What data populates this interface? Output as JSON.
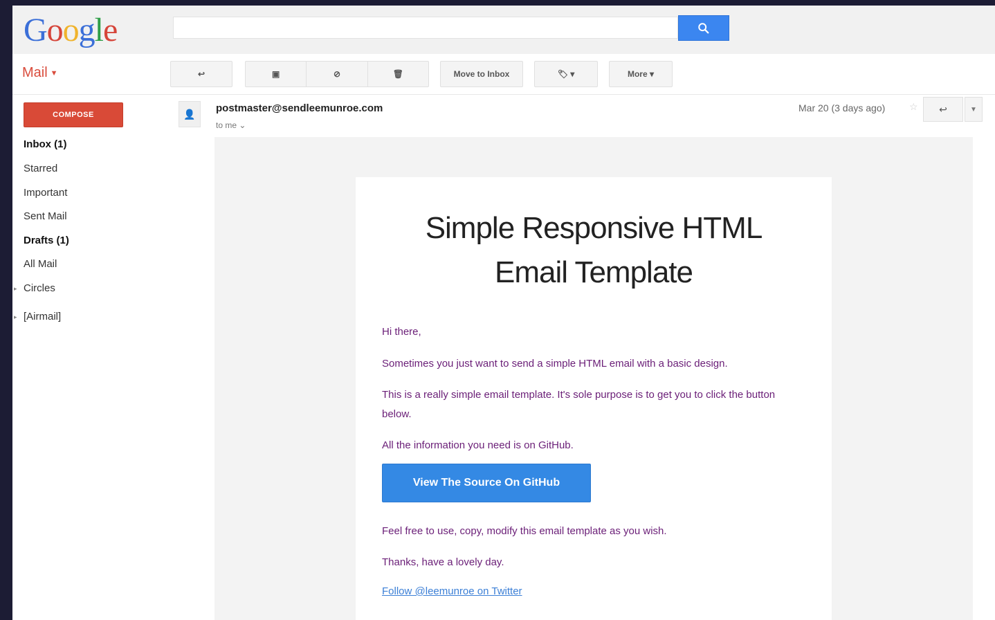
{
  "header": {
    "logo": {
      "g1": "G",
      "o1": "o",
      "o2": "o",
      "g2": "g",
      "l": "l",
      "e": "e"
    },
    "search": {
      "placeholder": ""
    }
  },
  "toolbar": {
    "mail_label": "Mail",
    "reply_label": "↩",
    "archive_label": "▣",
    "spam_label": "⊘",
    "delete_label": "🗑",
    "move_to_inbox_label": "Move to Inbox",
    "labels_label": "🏷 ▾",
    "more_label": "More ▾"
  },
  "sidebar": {
    "compose_label": "COMPOSE",
    "items": [
      {
        "label": "Inbox (1)",
        "bold": true
      },
      {
        "label": "Starred",
        "bold": false
      },
      {
        "label": "Important",
        "bold": false
      },
      {
        "label": "Sent Mail",
        "bold": false
      },
      {
        "label": "Drafts (1)",
        "bold": true
      },
      {
        "label": "All Mail",
        "bold": false
      },
      {
        "label": "Circles",
        "bold": false
      },
      {
        "label": "[Airmail]",
        "bold": false
      }
    ]
  },
  "message": {
    "sender": "postmaster@sendleemunroe.com",
    "to": "to me",
    "date": "Mar 20 (3 days ago)",
    "title_line1": "Simple Responsive HTML",
    "title_line2": "Email Template",
    "greeting": "Hi there,",
    "para1": "Sometimes you just want to send a simple HTML email with a basic design.",
    "para2": "This is a really simple email template. It's sole purpose is to get you to click the button below.",
    "para3": "All the information you need is on GitHub.",
    "cta": "View The Source On GitHub",
    "para4": "Feel free to use, copy, modify this email template as you wish.",
    "para5": "Thanks, have a lovely day.",
    "twitter": "Follow @leemunroe on Twitter"
  },
  "colors": {
    "compose": "#d94a37",
    "search_button": "#3b86f0",
    "cta_button": "#3489e4",
    "body_text": "#6a1e77",
    "link": "#3b7fd6"
  }
}
